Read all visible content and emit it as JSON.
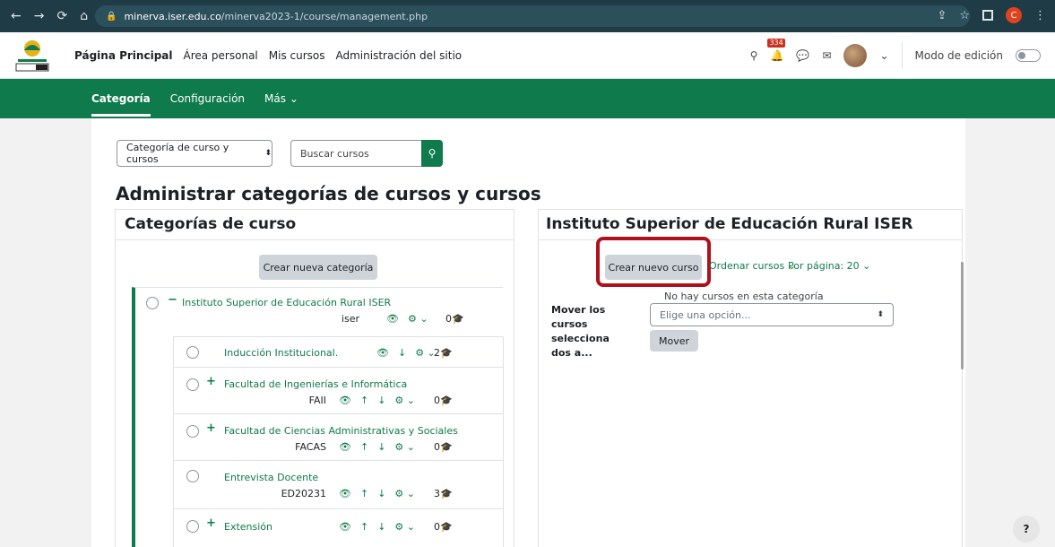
{
  "browser": {
    "url_host": "minerva.iser.edu.co",
    "url_path": "/minerva2023-1/course/management.php",
    "profile_initial": "C"
  },
  "navbar": {
    "items": [
      "Página Principal",
      "Área personal",
      "Mis cursos",
      "Administración del sitio"
    ],
    "notification_count": "334",
    "edit_mode_label": "Modo de edición"
  },
  "secondary_nav": {
    "tabs": [
      "Categoría",
      "Configuración",
      "Más"
    ]
  },
  "controls": {
    "selector_value": "Categoría de curso y cursos",
    "search_placeholder": "Buscar cursos"
  },
  "page_title": "Administrar categorías de cursos y cursos",
  "left_panel": {
    "heading": "Categorías de curso",
    "new_category_button": "Crear nueva categoría",
    "root": {
      "name": "Instituto Superior de Educación Rural ISER",
      "idnumber": "iser",
      "count": "0"
    },
    "children": [
      {
        "name": "Inducción Institucional.",
        "idnumber": "",
        "count": "2",
        "expandable": false
      },
      {
        "name": "Facultad de Ingenierías e Informática",
        "idnumber": "FAII",
        "count": "0",
        "expandable": true
      },
      {
        "name": "Facultad de Ciencias Administrativas y Sociales",
        "idnumber": "FACAS",
        "count": "0",
        "expandable": true
      },
      {
        "name": "Entrevista Docente",
        "idnumber": "ED20231",
        "count": "3",
        "expandable": false
      },
      {
        "name": "Extensión",
        "idnumber": "",
        "count": "0",
        "expandable": true
      }
    ]
  },
  "right_panel": {
    "heading": "Instituto Superior de Educación Rural ISER",
    "new_course_button": "Crear nuevo curso",
    "sort_link": "Ordenar cursos",
    "per_page_link": "Por página: 20",
    "empty_message": "No hay cursos en esta categoría",
    "move_label": "Mover los cursos selecciona dos a...",
    "move_select_placeholder": "Elige una opción...",
    "move_button": "Mover"
  },
  "help_button": "?",
  "colors": {
    "brand": "#0f7a4b",
    "highlight": "#b0101c"
  }
}
